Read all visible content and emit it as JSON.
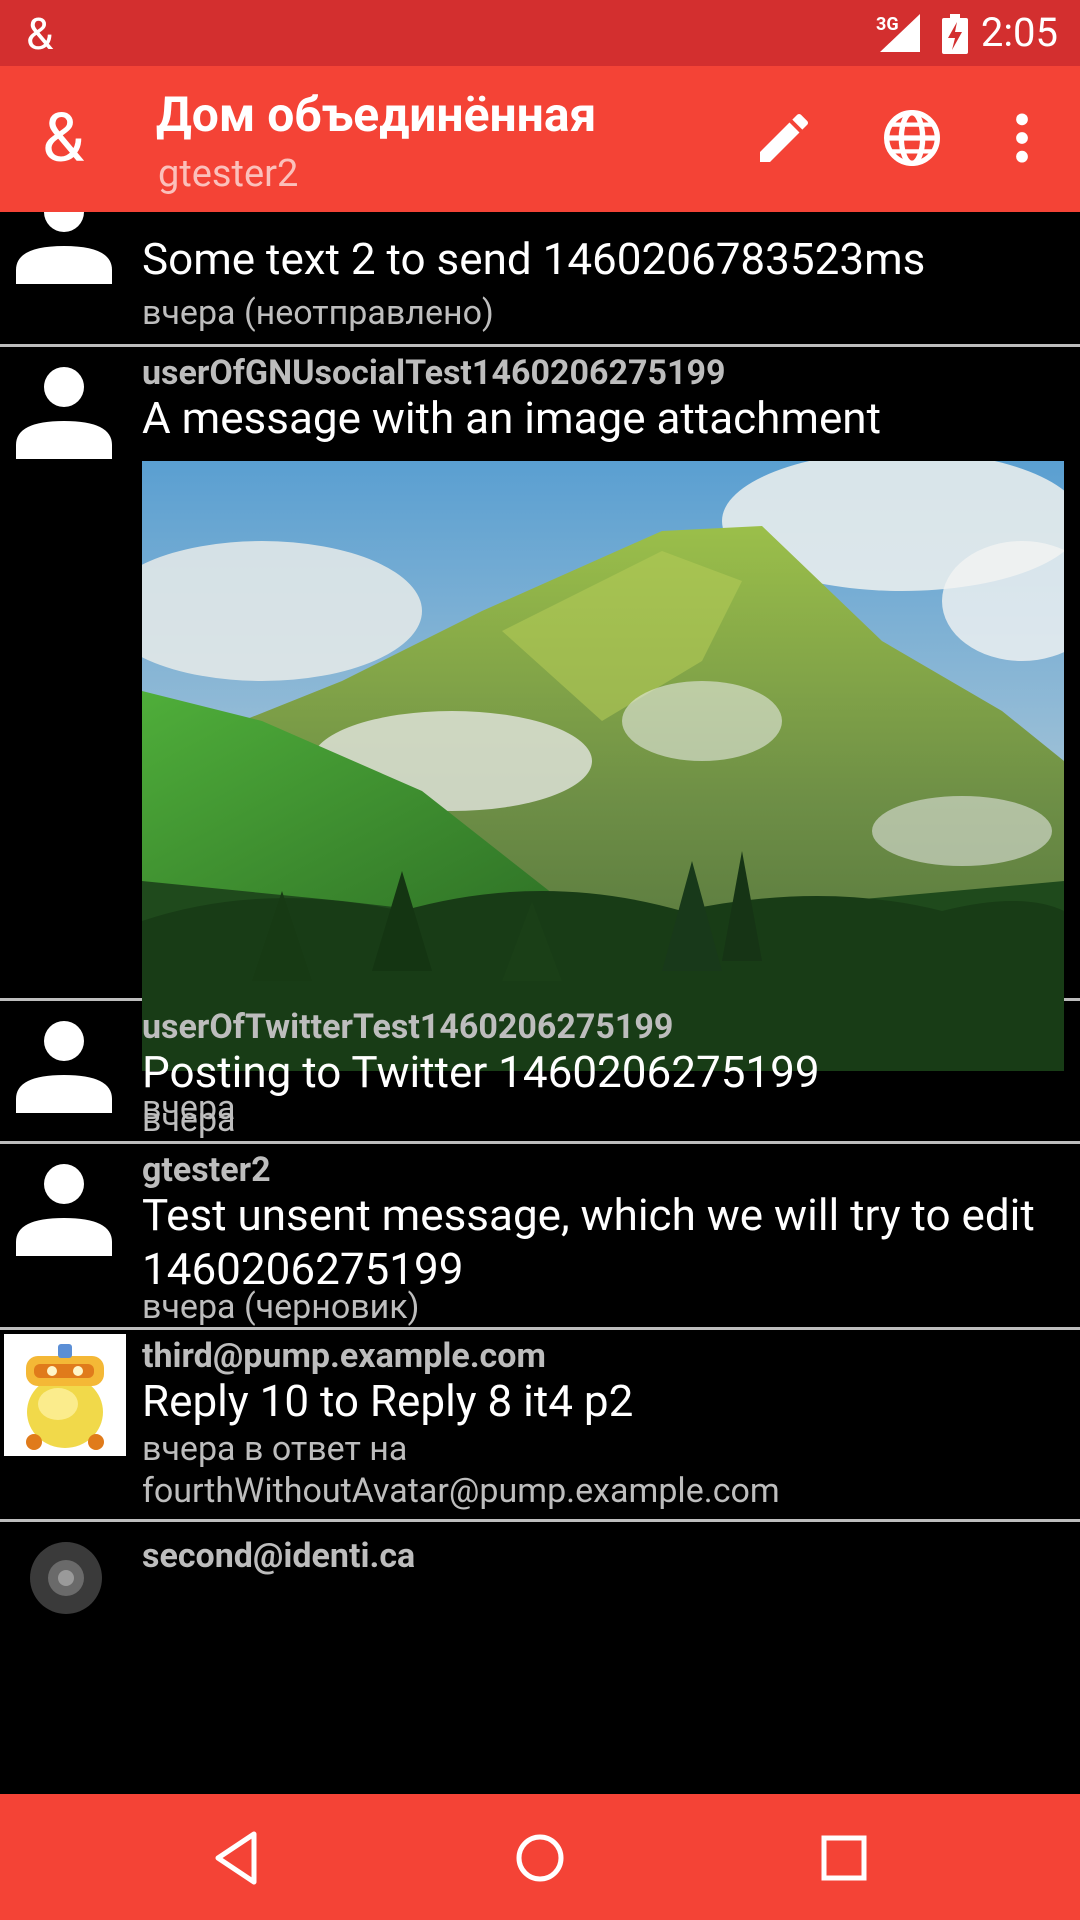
{
  "status_bar": {
    "network_type": "3G",
    "time": "2:05",
    "app_icon": "ampersand-icon",
    "color": "#d32f2f"
  },
  "toolbar": {
    "title": "Дом объединённая",
    "subtitle": "gtester2",
    "color": "#f44336",
    "icons": [
      "ampersand-logo-icon",
      "edit-pencil-icon",
      "globe-icon",
      "more-vert-icon"
    ]
  },
  "timeline": [
    {
      "author": "",
      "body": "Some text 2 to send 1460206783523ms",
      "meta": "вчера (неотправлено)",
      "avatar": "default-person-icon"
    },
    {
      "author": "userOfGNUsocialTest1460206275199",
      "body": "A message with an image attachment",
      "meta": "вчера",
      "avatar": "default-person-icon",
      "attachment": "mountain-landscape-image"
    },
    {
      "author": "userOfTwitterTest1460206275199",
      "body": "Posting to Twitter 1460206275199",
      "meta": "вчера",
      "avatar": "default-person-icon"
    },
    {
      "author": "gtester2",
      "body": "Test unsent message, which we will try to edit 1460206275199",
      "meta": "вчера (черновик)",
      "avatar": "default-person-icon"
    },
    {
      "author": "third@pump.example.com",
      "body": "Reply 10 to Reply 8 it4 p2",
      "meta_line1": "вчера в ответ на",
      "meta_line2": "fourthWithoutAvatar@pump.example.com",
      "avatar": "robot-avatar-image"
    },
    {
      "author": "second@identi.ca",
      "avatar": "dark-avatar-image"
    }
  ],
  "nav_bar": {
    "buttons": [
      "back-icon",
      "home-icon",
      "recents-icon"
    ],
    "color": "#f44336"
  }
}
